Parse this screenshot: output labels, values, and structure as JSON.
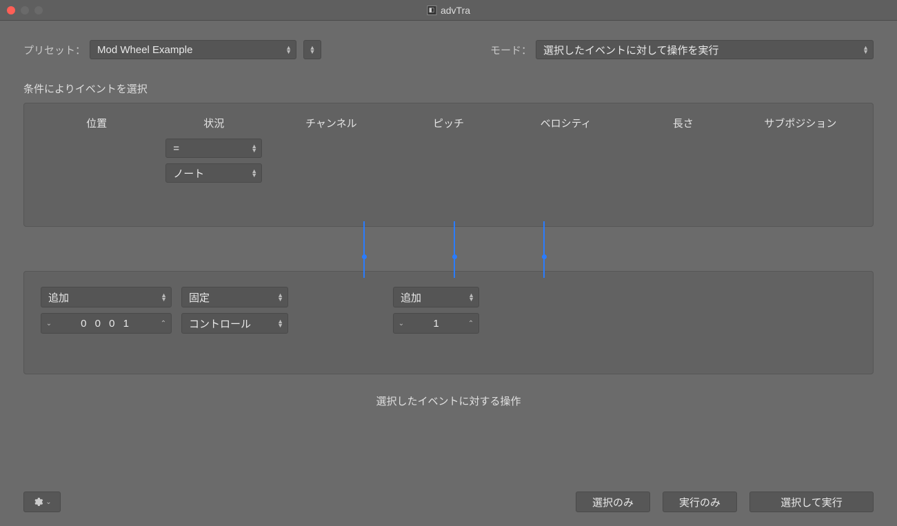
{
  "window": {
    "title": "advTra"
  },
  "top": {
    "preset_label": "プリセット：",
    "preset_value": "Mod Wheel Example",
    "mode_label": "モード：",
    "mode_value": "選択したイベントに対して操作を実行"
  },
  "conditions": {
    "title": "条件によりイベントを選択",
    "headers": [
      "位置",
      "状況",
      "チャンネル",
      "ピッチ",
      "ベロシティ",
      "長さ",
      "サブポジション"
    ],
    "status_operator": "=",
    "status_value": "ノート"
  },
  "actions": {
    "col1_op": "追加",
    "col1_val": "0 0 0    1",
    "col2_op": "固定",
    "col2_val": "コントロール",
    "col3_op": "追加",
    "col3_val": "1"
  },
  "mid_caption": "選択したイベントに対する操作",
  "buttons": {
    "select_only": "選択のみ",
    "execute_only": "実行のみ",
    "select_and_execute": "選択して実行"
  }
}
